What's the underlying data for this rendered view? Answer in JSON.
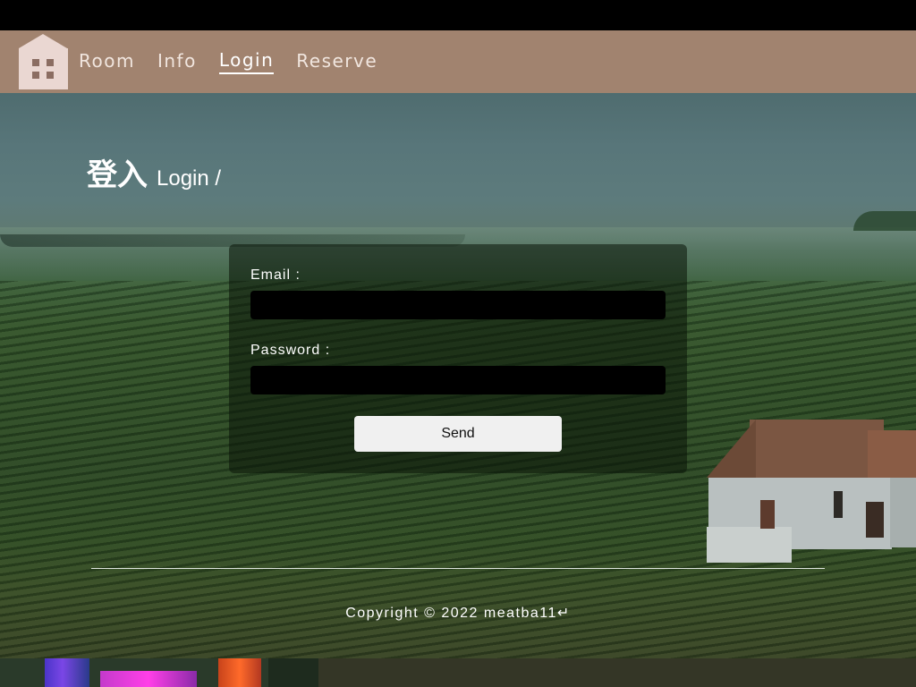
{
  "nav": {
    "items": [
      {
        "label": "Room",
        "active": false
      },
      {
        "label": "Info",
        "active": false
      },
      {
        "label": "Login",
        "active": true
      },
      {
        "label": "Reserve",
        "active": false
      }
    ]
  },
  "heading": {
    "zh": "登入",
    "en": "Login /"
  },
  "form": {
    "email_label": "Email :",
    "email_value": "",
    "password_label": "Password :",
    "password_value": "",
    "submit_label": "Send"
  },
  "footer": {
    "copyright": "Copyright © 2022 meatba11↵"
  },
  "colors": {
    "navbar": "#a1836f",
    "logo": "#ead7d2",
    "input_bg": "#000000",
    "button_bg": "#f0f0f0"
  }
}
